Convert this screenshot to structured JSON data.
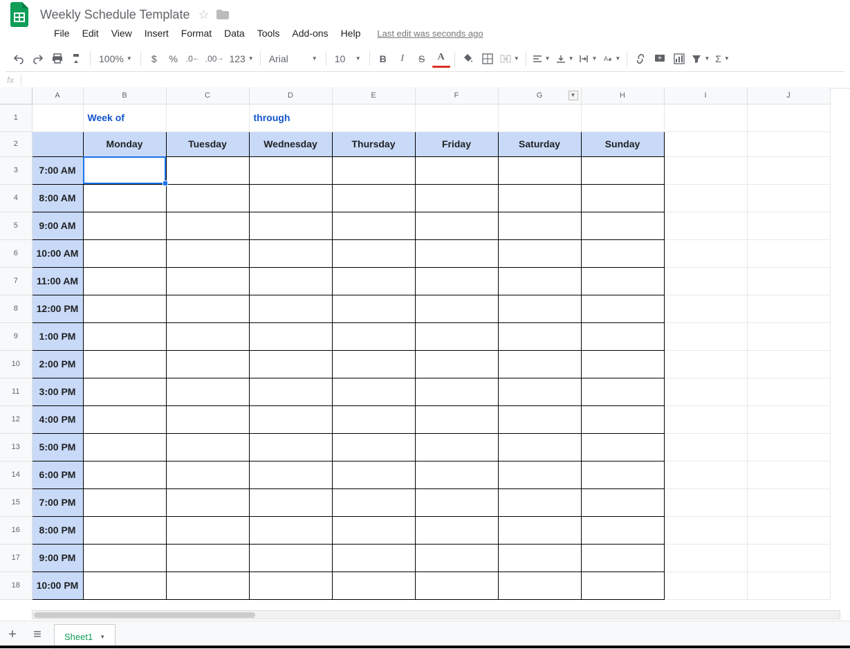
{
  "doc": {
    "title": "Weekly Schedule Template",
    "last_edit": "Last edit was seconds ago"
  },
  "menus": [
    "File",
    "Edit",
    "View",
    "Insert",
    "Format",
    "Data",
    "Tools",
    "Add-ons",
    "Help"
  ],
  "toolbar": {
    "zoom": "100%",
    "format_more": "123",
    "font": "Arial",
    "size": "10"
  },
  "formula": {
    "fx": "fx",
    "value": ""
  },
  "columns": [
    "A",
    "B",
    "C",
    "D",
    "E",
    "F",
    "G",
    "H",
    "I",
    "J"
  ],
  "row1": {
    "b": "Week of",
    "d": "through"
  },
  "days": [
    "Monday",
    "Tuesday",
    "Wednesday",
    "Thursday",
    "Friday",
    "Saturday",
    "Sunday"
  ],
  "times": [
    "7:00 AM",
    "8:00 AM",
    "9:00 AM",
    "10:00 AM",
    "11:00 AM",
    "12:00 PM",
    "1:00 PM",
    "2:00 PM",
    "3:00 PM",
    "4:00 PM",
    "5:00 PM",
    "6:00 PM",
    "7:00 PM",
    "8:00 PM",
    "9:00 PM",
    "10:00 PM"
  ],
  "tabs": {
    "sheet1": "Sheet1"
  }
}
